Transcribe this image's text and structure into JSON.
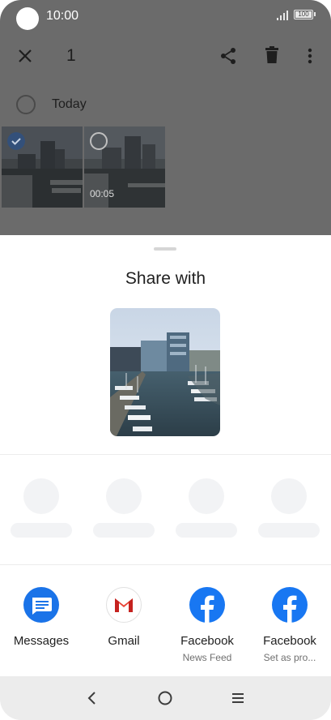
{
  "status_bar": {
    "time": "10:00",
    "battery": "100"
  },
  "toolbar": {
    "selected_count": "1"
  },
  "gallery": {
    "group_label": "Today",
    "items": [
      {
        "kind": "photo",
        "selected": true
      },
      {
        "kind": "video",
        "selected": false,
        "duration": "00:05"
      }
    ]
  },
  "share_sheet": {
    "title": "Share with",
    "apps": [
      {
        "label": "Messages",
        "sub": "",
        "icon": "messages-icon"
      },
      {
        "label": "Gmail",
        "sub": "",
        "icon": "gmail-icon"
      },
      {
        "label": "Facebook",
        "sub": "News Feed",
        "icon": "facebook-icon"
      },
      {
        "label": "Facebook",
        "sub": "Set as pro...",
        "icon": "facebook-icon"
      }
    ]
  },
  "colors": {
    "accent": "#1a73e8",
    "facebook": "#1877f2",
    "overlay": "#6b6b6b",
    "nav_bar": "#ececec"
  }
}
